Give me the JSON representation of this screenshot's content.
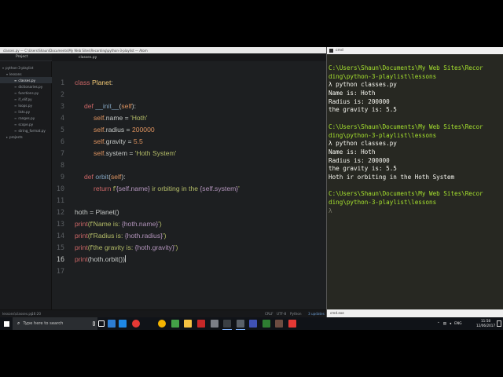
{
  "atom": {
    "window_title": "classes.py — C:\\Users\\Shaun\\Documents\\My Web Sites\\Recording\\python-3-playlist — Atom",
    "tree_tab": "Project",
    "file_tab": "classes.py",
    "tree_items": [
      {
        "label": "python-3-playlist",
        "glyph": "▾"
      },
      {
        "label": "lessons",
        "glyph": "▾"
      },
      {
        "label": "classes.py",
        "glyph": "≡"
      },
      {
        "label": "dictionaries.py",
        "glyph": "≡"
      },
      {
        "label": "functions.py",
        "glyph": "≡"
      },
      {
        "label": "if_elif.py",
        "glyph": "≡"
      },
      {
        "label": "loops.py",
        "glyph": "≡"
      },
      {
        "label": "lists.py",
        "glyph": "≡"
      },
      {
        "label": "ranges.py",
        "glyph": "≡"
      },
      {
        "label": "scope.py",
        "glyph": "≡"
      },
      {
        "label": "string_format.py",
        "glyph": "≡"
      },
      {
        "label": "projects",
        "glyph": "▸"
      }
    ],
    "line_numbers": [
      "1",
      "2",
      "3",
      "4",
      "5",
      "6",
      "7",
      "8",
      "9",
      "10",
      "11",
      "12",
      "13",
      "14",
      "15",
      "16",
      "17"
    ],
    "active_line": "16",
    "code": {
      "l1": [
        "class",
        "Planet",
        ":"
      ],
      "l3": [
        "def",
        "__init__",
        "(",
        "self",
        "):"
      ],
      "l4": [
        "self",
        ".name = ",
        "'Hoth'"
      ],
      "l5": [
        "self",
        ".radius = ",
        "200000"
      ],
      "l6": [
        "self",
        ".gravity = ",
        "5.5"
      ],
      "l7": [
        "self",
        ".system = ",
        "'Hoth System'"
      ],
      "l9": [
        "def",
        "orbit",
        "(",
        "self",
        "):"
      ],
      "l10": [
        "return",
        "f'",
        "{self.name}",
        " ir orbiting in the ",
        "{self.system}",
        "'"
      ],
      "l12": [
        "hoth = Planet()"
      ],
      "l13": [
        "print",
        "(f'Name is: ",
        "{hoth.name}",
        "')"
      ],
      "l14": [
        "print",
        "(f'Radius is: ",
        "{hoth.radius}",
        "')"
      ],
      "l15": [
        "print",
        "(f'the gravity is: ",
        "{hoth.gravity}",
        "')"
      ],
      "l16": [
        "print",
        "(hoth.orbit())"
      ]
    },
    "status": {
      "file": "lessons\\classes.py",
      "pos": "16:20",
      "eol": "CRLF",
      "encoding": "UTF-8",
      "grammar": "Python",
      "updates": "3 updates"
    }
  },
  "cmd": {
    "window_title": "cmd",
    "lines": [
      {
        "text": "C:\\Users\\Shaun\\Documents\\My Web Sites\\Recor",
        "kind": "path"
      },
      {
        "text": "ding\\python-3-playlist\\lessons",
        "kind": "path"
      },
      {
        "text": "λ python classes.py",
        "kind": "prompt"
      },
      {
        "text": "Name is: Hoth",
        "kind": "out"
      },
      {
        "text": "Radius is: 200000",
        "kind": "out"
      },
      {
        "text": "the gravity is: 5.5",
        "kind": "out"
      },
      {
        "text": "",
        "kind": "blank"
      },
      {
        "text": "C:\\Users\\Shaun\\Documents\\My Web Sites\\Recor",
        "kind": "path"
      },
      {
        "text": "ding\\python-3-playlist\\lessons",
        "kind": "path"
      },
      {
        "text": "λ python classes.py",
        "kind": "prompt"
      },
      {
        "text": "Name is: Hoth",
        "kind": "out"
      },
      {
        "text": "Radius is: 200000",
        "kind": "out"
      },
      {
        "text": "the gravity is: 5.5",
        "kind": "out"
      },
      {
        "text": "Hoth ir orbiting in the Hoth System",
        "kind": "out"
      },
      {
        "text": "",
        "kind": "blank"
      },
      {
        "text": "C:\\Users\\Shaun\\Documents\\My Web Sites\\Recor",
        "kind": "path"
      },
      {
        "text": "ding\\python-3-playlist\\lessons",
        "kind": "path"
      },
      {
        "text": "λ",
        "kind": "prompt-idle"
      }
    ],
    "status": "cmd.exe"
  },
  "taskbar": {
    "search_placeholder": "Type here to search",
    "lang": "ENG",
    "time": "11:58",
    "date": "12/06/2017",
    "icon_colors": [
      "#ffffff",
      "#2d7dd2",
      "#1e88e5",
      "#e53935",
      "#f4b400",
      "#43a047",
      "#f6c343",
      "#c62828",
      "#7b7f86",
      "#3a3f44",
      "#5a6068",
      "#3f51b5",
      "#2e7d32",
      "#6d4c41",
      "#e53935"
    ]
  }
}
